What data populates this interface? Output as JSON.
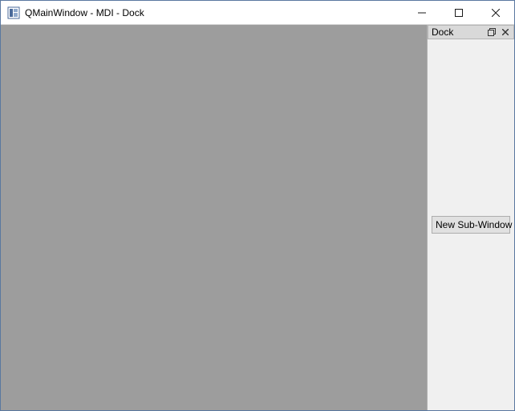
{
  "window": {
    "title": "QMainWindow - MDI - Dock"
  },
  "dock": {
    "title": "Dock",
    "button_label": "New Sub-Window"
  }
}
